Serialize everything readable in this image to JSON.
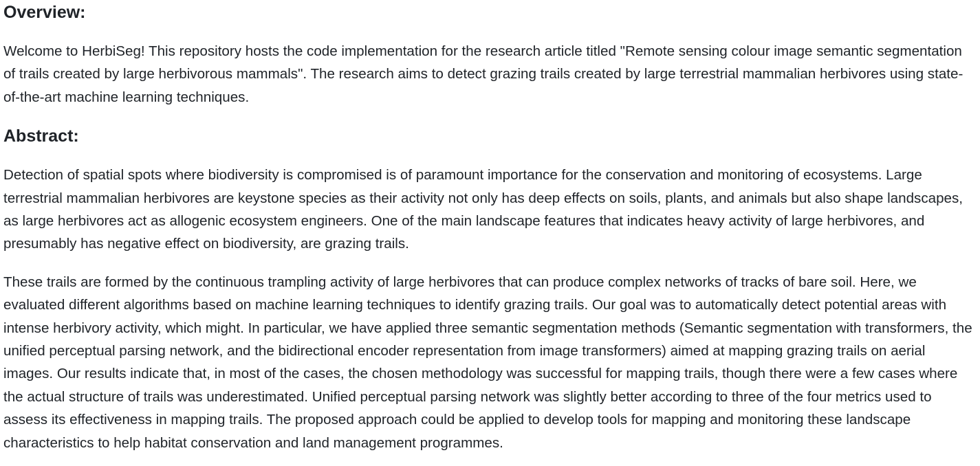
{
  "overview": {
    "heading": "Overview:",
    "text": "Welcome to HerbiSeg! This repository hosts the code implementation for the research article titled \"Remote sensing colour image semantic segmentation of trails created by large herbivorous mammals\". The research aims to detect grazing trails created by large terrestrial mammalian herbivores using state-of-the-art machine learning techniques."
  },
  "abstract": {
    "heading": "Abstract:",
    "paragraphs": [
      "Detection of spatial spots where biodiversity is compromised is of paramount importance for the conservation and monitoring of ecosystems. Large terrestrial mammalian herbivores are keystone species as their activity not only has deep effects on soils, plants, and animals but also shape landscapes, as large herbivores act as allogenic ecosystem engineers. One of the main landscape features that indicates heavy activity of large herbivores, and presumably has negative effect on biodiversity, are grazing trails.",
      "These trails are formed by the continuous trampling activity of large herbivores that can produce complex networks of tracks of bare soil. Here, we evaluated different algorithms based on machine learning techniques to identify grazing trails. Our goal was to automatically detect potential areas with intense herbivory activity, which might. In particular, we have applied three semantic segmentation methods (Semantic segmentation with transformers, the unified perceptual parsing network, and the bidirectional encoder representation from image transformers) aimed at mapping grazing trails on aerial images. Our results indicate that, in most of the cases, the chosen methodology was successful for mapping trails, though there were a few cases where the actual structure of trails was underestimated. Unified perceptual parsing network was slightly better according to three of the four metrics used to assess its effectiveness in mapping trails. The proposed approach could be applied to develop tools for mapping and monitoring these landscape characteristics to help habitat conservation and land management programmes."
    ]
  }
}
